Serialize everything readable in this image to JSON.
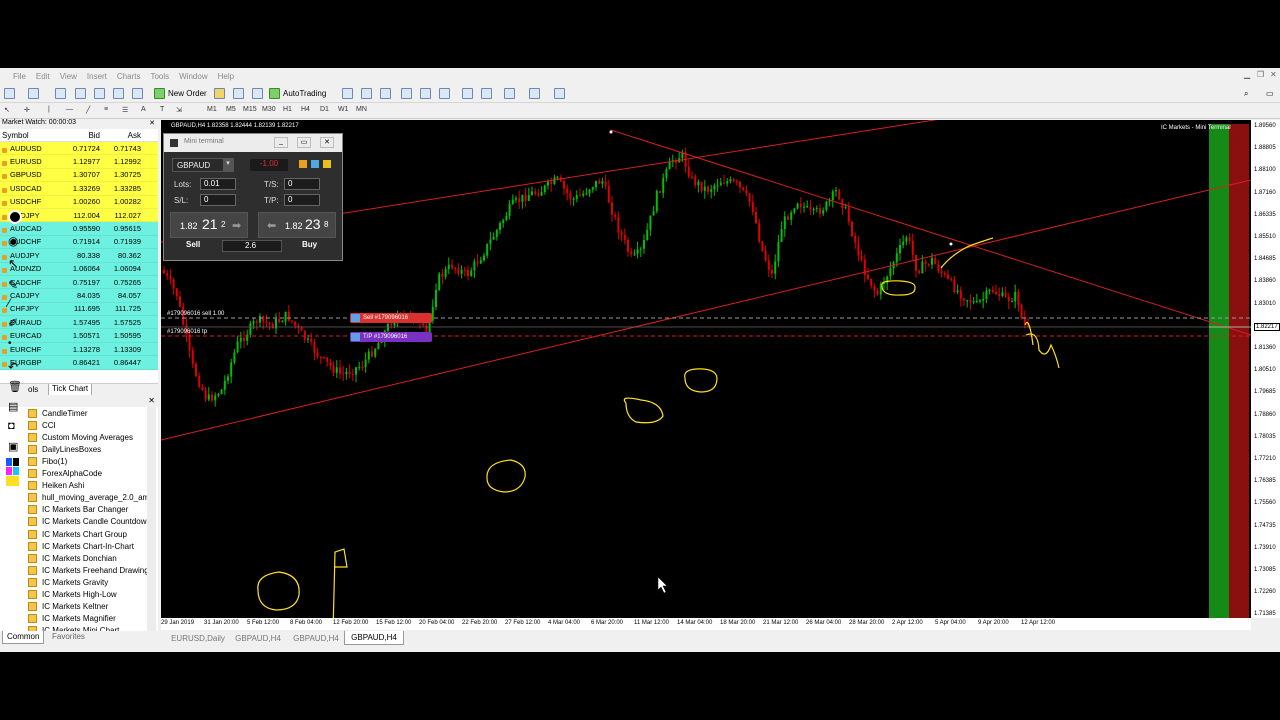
{
  "menu": [
    "File",
    "Edit",
    "View",
    "Insert",
    "Charts",
    "Tools",
    "Window",
    "Help"
  ],
  "toolbar": {
    "new_order": "New Order",
    "autotrading": "AutoTrading"
  },
  "timeframes": [
    "M1",
    "M5",
    "M15",
    "M30",
    "H1",
    "H4",
    "D1",
    "W1",
    "MN"
  ],
  "market_watch": {
    "title": "Market Watch: 00:00:03",
    "headers": {
      "symbol": "Symbol",
      "bid": "Bid",
      "ask": "Ask"
    },
    "rows": [
      {
        "symbol": "AUDUSD",
        "bid": "0.71724",
        "ask": "0.71743"
      },
      {
        "symbol": "EURUSD",
        "bid": "1.12977",
        "ask": "1.12992"
      },
      {
        "symbol": "GBPUSD",
        "bid": "1.30707",
        "ask": "1.30725"
      },
      {
        "symbol": "USDCAD",
        "bid": "1.33269",
        "ask": "1.33285"
      },
      {
        "symbol": "USDCHF",
        "bid": "1.00260",
        "ask": "1.00282"
      },
      {
        "symbol": "USDJPY",
        "bid": "112.004",
        "ask": "112.027"
      },
      {
        "symbol": "AUDCAD",
        "bid": "0.95590",
        "ask": "0.95615"
      },
      {
        "symbol": "AUDCHF",
        "bid": "0.71914",
        "ask": "0.71939"
      },
      {
        "symbol": "AUDJPY",
        "bid": "80.338",
        "ask": "80.362"
      },
      {
        "symbol": "AUDNZD",
        "bid": "1.06064",
        "ask": "1.06094"
      },
      {
        "symbol": "CADCHF",
        "bid": "0.75197",
        "ask": "0.75265"
      },
      {
        "symbol": "CADJPY",
        "bid": "84.035",
        "ask": "84.057"
      },
      {
        "symbol": "CHFJPY",
        "bid": "111.695",
        "ask": "111.725"
      },
      {
        "symbol": "EURAUD",
        "bid": "1.57495",
        "ask": "1.57525"
      },
      {
        "symbol": "EURCAD",
        "bid": "1.50571",
        "ask": "1.50595"
      },
      {
        "symbol": "EURCHF",
        "bid": "1.13278",
        "ask": "1.13309"
      },
      {
        "symbol": "EURGBP",
        "bid": "0.86421",
        "ask": "0.86447"
      }
    ]
  },
  "mw_tabs": {
    "symbols": "ols",
    "tick": "Tick Chart"
  },
  "navigator": {
    "items": [
      "CandleTimer",
      "CCI",
      "Custom Moving Averages",
      "DailyLinesBoxes",
      "Fibo(1)",
      "ForexAlphaCode",
      "Heiken Ashi",
      "hull_moving_average_2.0_am",
      "IC Markets Bar Changer",
      "IC Markets Candle Countdown",
      "IC Markets Chart Group",
      "IC Markets Chart-In-Chart",
      "IC Markets Donchian",
      "IC Markets Freehand Drawing",
      "IC Markets Gravity",
      "IC Markets High-Low",
      "IC Markets Keltner",
      "IC Markets Magnifier",
      "IC Markets Mini Chart"
    ],
    "tabs": [
      "Common",
      "Favorites"
    ]
  },
  "chart": {
    "header": "GBPAUD,H4  1.82358 1.82444 1.82139 1.82217",
    "broker": "IC Markets - Mini Terminal",
    "sell_line_label": "#179096016 sell 1.00",
    "tp_line_label": "#179096016 tp",
    "sell_tag": "Sell #179096016",
    "tp_tag": "T/P #179096016",
    "current_price": "1.82217",
    "y_labels": [
      "1.89560",
      "1.88805",
      "1.88100",
      "1.87160",
      "1.86335",
      "1.85510",
      "1.84685",
      "1.83860",
      "1.83010",
      "1.82217",
      "1.81360",
      "1.80510",
      "1.79685",
      "1.78860",
      "1.78035",
      "1.77210",
      "1.76385",
      "1.75560",
      "1.74735",
      "1.73910",
      "1.73085",
      "1.72260",
      "1.71385"
    ],
    "x_labels": [
      "29 Jan 2019",
      "31 Jan 20:00",
      "5 Feb 12:00",
      "8 Feb 04:00",
      "12 Feb 20:00",
      "15 Feb 12:00",
      "20 Feb 04:00",
      "22 Feb 20:00",
      "27 Feb 12:00",
      "4 Mar 04:00",
      "6 Mar 20:00",
      "11 Mar 12:00",
      "14 Mar 04:00",
      "18 Mar 20:00",
      "21 Mar 12:00",
      "26 Mar 04:00",
      "28 Mar 20:00",
      "2 Apr 12:00",
      "5 Apr 04:00",
      "9 Apr 20:00",
      "12 Apr 12:00"
    ],
    "tabs": [
      "EURUSD,Daily",
      "GBPAUD,H4",
      "GBPAUD,H4",
      "GBPAUD,H4"
    ]
  },
  "mini_terminal": {
    "title": "Mini terminal",
    "symbol": "GBPAUD",
    "pl": "-1.00",
    "lots_label": "Lots:",
    "lots": "0.01",
    "sl_label": "S/L:",
    "sl": "0",
    "ts_label": "T/S:",
    "ts": "0",
    "tp_label": "T/P:",
    "tp": "0",
    "sell_prefix": "1.82",
    "sell_big": "21",
    "sell_sup": "2",
    "buy_prefix": "1.82",
    "buy_big": "23",
    "buy_sup": "8",
    "sell": "Sell",
    "buy": "Buy",
    "spread": "2.6"
  },
  "colors": {
    "bull": "#00c000",
    "bear": "#e00000",
    "trendline": "#d42020",
    "annotation": "#ffe020"
  }
}
